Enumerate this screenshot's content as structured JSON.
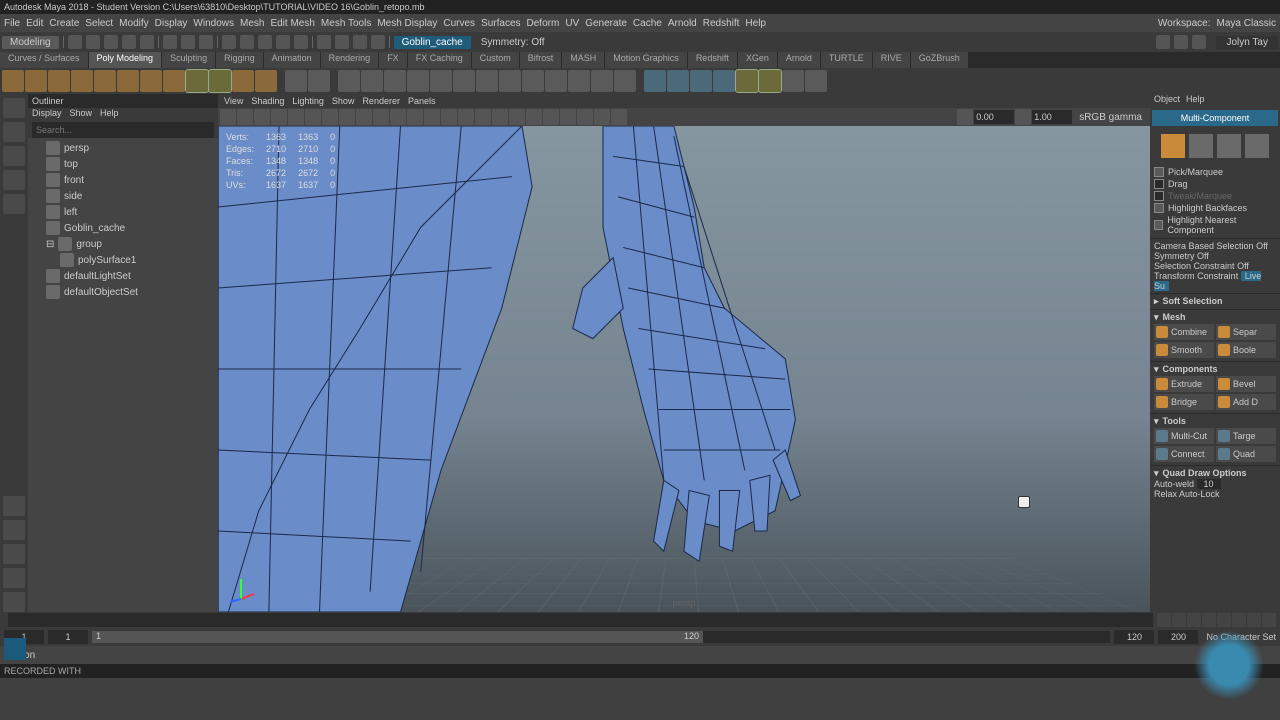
{
  "title": "Autodesk Maya 2018 - Student Version   C:\\Users\\63810\\Desktop\\TUTORIAL\\VIDEO 16\\Goblin_retopo.mb",
  "menus": [
    "File",
    "Edit",
    "Create",
    "Select",
    "Modify",
    "Display",
    "Windows",
    "Mesh",
    "Edit Mesh",
    "Mesh Tools",
    "Mesh Display",
    "Curves",
    "Surfaces",
    "Deform",
    "UV",
    "Generate",
    "Cache",
    "Arnold",
    "Redshift",
    "Help"
  ],
  "workspace": {
    "label": "Workspace:",
    "value": "Maya Classic"
  },
  "mode": "Modeling",
  "object_tag": "Goblin_cache",
  "symmetry": {
    "label": "Symmetry:",
    "value": "Off"
  },
  "user": "Jolyn Tay",
  "shelf_tabs": [
    "Curves / Surfaces",
    "Poly Modeling",
    "Sculpting",
    "Rigging",
    "Animation",
    "Rendering",
    "FX",
    "FX Caching",
    "Custom",
    "Bifrost",
    "MASH",
    "Motion Graphics",
    "Redshift",
    "XGen",
    "Arnold",
    "TURTLE",
    "RIVE",
    "GoZBrush"
  ],
  "outliner": {
    "title": "Outliner",
    "menu": [
      "Display",
      "Show",
      "Help"
    ],
    "search_placeholder": "Search...",
    "items": [
      {
        "label": "persp",
        "indent": 1
      },
      {
        "label": "top",
        "indent": 1
      },
      {
        "label": "front",
        "indent": 1
      },
      {
        "label": "side",
        "indent": 1
      },
      {
        "label": "left",
        "indent": 1
      },
      {
        "label": "Goblin_cache",
        "indent": 1
      },
      {
        "label": "group",
        "indent": 1,
        "expand": true
      },
      {
        "label": "polySurface1",
        "indent": 2
      },
      {
        "label": "defaultLightSet",
        "indent": 1
      },
      {
        "label": "defaultObjectSet",
        "indent": 1
      }
    ]
  },
  "viewport": {
    "menu": [
      "View",
      "Shading",
      "Lighting",
      "Show",
      "Renderer",
      "Panels"
    ],
    "exposure": "0.00",
    "gamma": "1.00",
    "colorspace": "sRGB gamma",
    "camera": "persp",
    "hud": {
      "rows": [
        {
          "k": "Verts:",
          "a": "1363",
          "b": "1363",
          "c": "0"
        },
        {
          "k": "Edges:",
          "a": "2710",
          "b": "2710",
          "c": "0"
        },
        {
          "k": "Faces:",
          "a": "1348",
          "b": "1348",
          "c": "0"
        },
        {
          "k": "Tris:",
          "a": "2672",
          "b": "2672",
          "c": "0"
        },
        {
          "k": "UVs:",
          "a": "1637",
          "b": "1637",
          "c": "0"
        }
      ]
    }
  },
  "right": {
    "menu": [
      "Object",
      "Help"
    ],
    "mc": "Multi-Component",
    "pick_opts": [
      "Pick/Marquee",
      "Drag",
      "Tweak/Marquee",
      "Highlight Backfaces",
      "Highlight Nearest Component"
    ],
    "pick_checked": [
      true,
      false,
      false,
      true,
      true
    ],
    "camera_sel": {
      "label": "Camera Based Selection",
      "value": "Off"
    },
    "symmetry": {
      "label": "Symmetry",
      "value": "Off"
    },
    "sel_constraint": {
      "label": "Selection Constraint",
      "value": "Off"
    },
    "trans_constraint": {
      "label": "Transform Constraint",
      "value": "Live Su"
    },
    "soft_sel": "Soft Selection",
    "mesh": {
      "title": "Mesh",
      "buttons": [
        [
          "Combine",
          "Separ"
        ],
        [
          "Smooth",
          "Boole"
        ]
      ]
    },
    "components": {
      "title": "Components",
      "buttons": [
        [
          "Extrude",
          "Bevel"
        ],
        [
          "Bridge",
          "Add D"
        ]
      ]
    },
    "tools": {
      "title": "Tools",
      "buttons": [
        [
          "Multi-Cut",
          "Targe"
        ],
        [
          "Connect",
          "Quad"
        ]
      ]
    },
    "quad": {
      "title": "Quad Draw Options",
      "auto_weld": "Auto-weld",
      "auto_weld_val": "10",
      "relax": "Relax",
      "auto_lock": "Auto-Lock"
    }
  },
  "time": {
    "start": "1",
    "rstart": "1",
    "end": "120",
    "rend": "200",
    "current": "1",
    "charset": "No Character Set"
  },
  "cmd_lang": "Python",
  "recorded": "RECORDED WITH"
}
